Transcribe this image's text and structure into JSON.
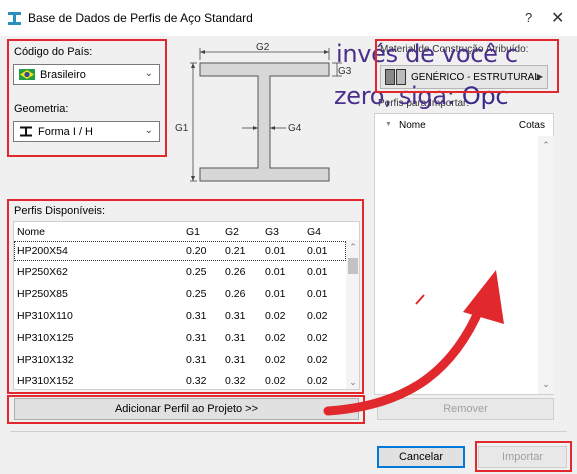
{
  "window": {
    "title": "Base de Dados de Perfis de Aço Standard",
    "help": "?",
    "close": "✕"
  },
  "country": {
    "label": "Código do País:",
    "value": "Brasileiro"
  },
  "geometry": {
    "label": "Geometria:",
    "value": "Forma I / H"
  },
  "diagram": {
    "g1": "G1",
    "g2": "G2",
    "g3": "G3",
    "g4": "G4"
  },
  "material": {
    "label": "Material de Construção Atribuído:",
    "value": "GENÉRICO - ESTRUTURAL"
  },
  "overlay": {
    "line1": "invés de você c",
    "line2_a": "zero, siga: ",
    "line2_b": "Opc"
  },
  "import_list": {
    "label": "Perfis para Importar:",
    "columns": [
      "Nome",
      "Cotas"
    ]
  },
  "available": {
    "label": "Perfis Disponíveis:",
    "columns": [
      "Nome",
      "G1",
      "G2",
      "G3",
      "G4"
    ],
    "rows": [
      [
        "HP200X54",
        "0.20",
        "0.21",
        "0.01",
        "0.01"
      ],
      [
        "HP250X62",
        "0.25",
        "0.26",
        "0.01",
        "0.01"
      ],
      [
        "HP250X85",
        "0.25",
        "0.26",
        "0.01",
        "0.01"
      ],
      [
        "HP310X110",
        "0.31",
        "0.31",
        "0.02",
        "0.02"
      ],
      [
        "HP310X125",
        "0.31",
        "0.31",
        "0.02",
        "0.02"
      ],
      [
        "HP310X132",
        "0.31",
        "0.31",
        "0.02",
        "0.02"
      ],
      [
        "HP310X152",
        "0.32",
        "0.32",
        "0.02",
        "0.02"
      ]
    ]
  },
  "buttons": {
    "add": "Adicionar Perfil ao Projeto >>",
    "remove": "Remover",
    "cancel": "Cancelar",
    "import": "Importar"
  },
  "colors": {
    "highlight_red": "#e0282d",
    "default_button_border": "#0078d7",
    "overlay_text": "#4b2f8c",
    "disabled_text": "#a0a0a0"
  }
}
